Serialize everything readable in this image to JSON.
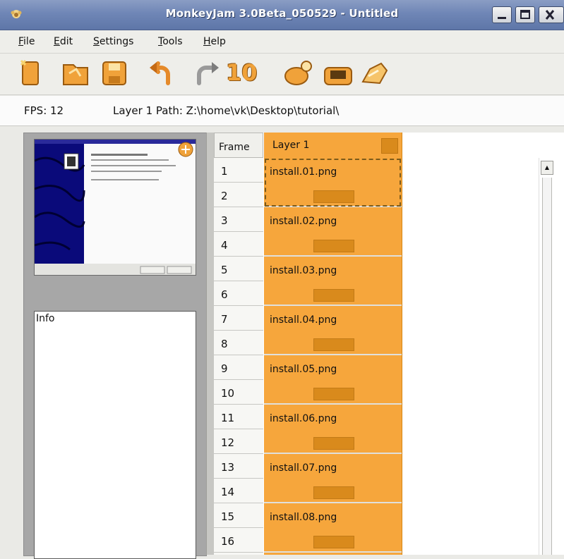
{
  "window": {
    "title": "MonkeyJam 3.0Beta_050529 - Untitled"
  },
  "menu": [
    "File",
    "Edit",
    "Settings",
    "Tools",
    "Help"
  ],
  "toolbar": {
    "count_button_label": "10",
    "icons": [
      "new-icon",
      "open-icon",
      "save-icon",
      "undo-icon",
      "redo-icon",
      "count-icon",
      "capture-icon",
      "camera-icon",
      "export-icon"
    ]
  },
  "infobar": {
    "fps": "FPS: 12",
    "path": "Layer 1 Path: Z:\\home\\vk\\Desktop\\tutorial\\"
  },
  "left_panel": {
    "info_label": "Info"
  },
  "grid": {
    "frame_header": "Frame",
    "layer_name": "Layer 1",
    "frames": [
      "1",
      "2",
      "3",
      "4",
      "5",
      "6",
      "7",
      "8",
      "9",
      "10",
      "11",
      "12",
      "13",
      "14",
      "15",
      "16"
    ],
    "cells": [
      "install.01.png",
      "install.02.png",
      "install.03.png",
      "install.04.png",
      "install.05.png",
      "install.06.png",
      "install.07.png",
      "install.08.png"
    ],
    "selected_cell": 0
  },
  "colors": {
    "layer_orange": "#f6a63c",
    "frame_bar": "#d98a1c",
    "titlebar": "#6f86b6",
    "preview_blue": "#0a0a7a"
  }
}
